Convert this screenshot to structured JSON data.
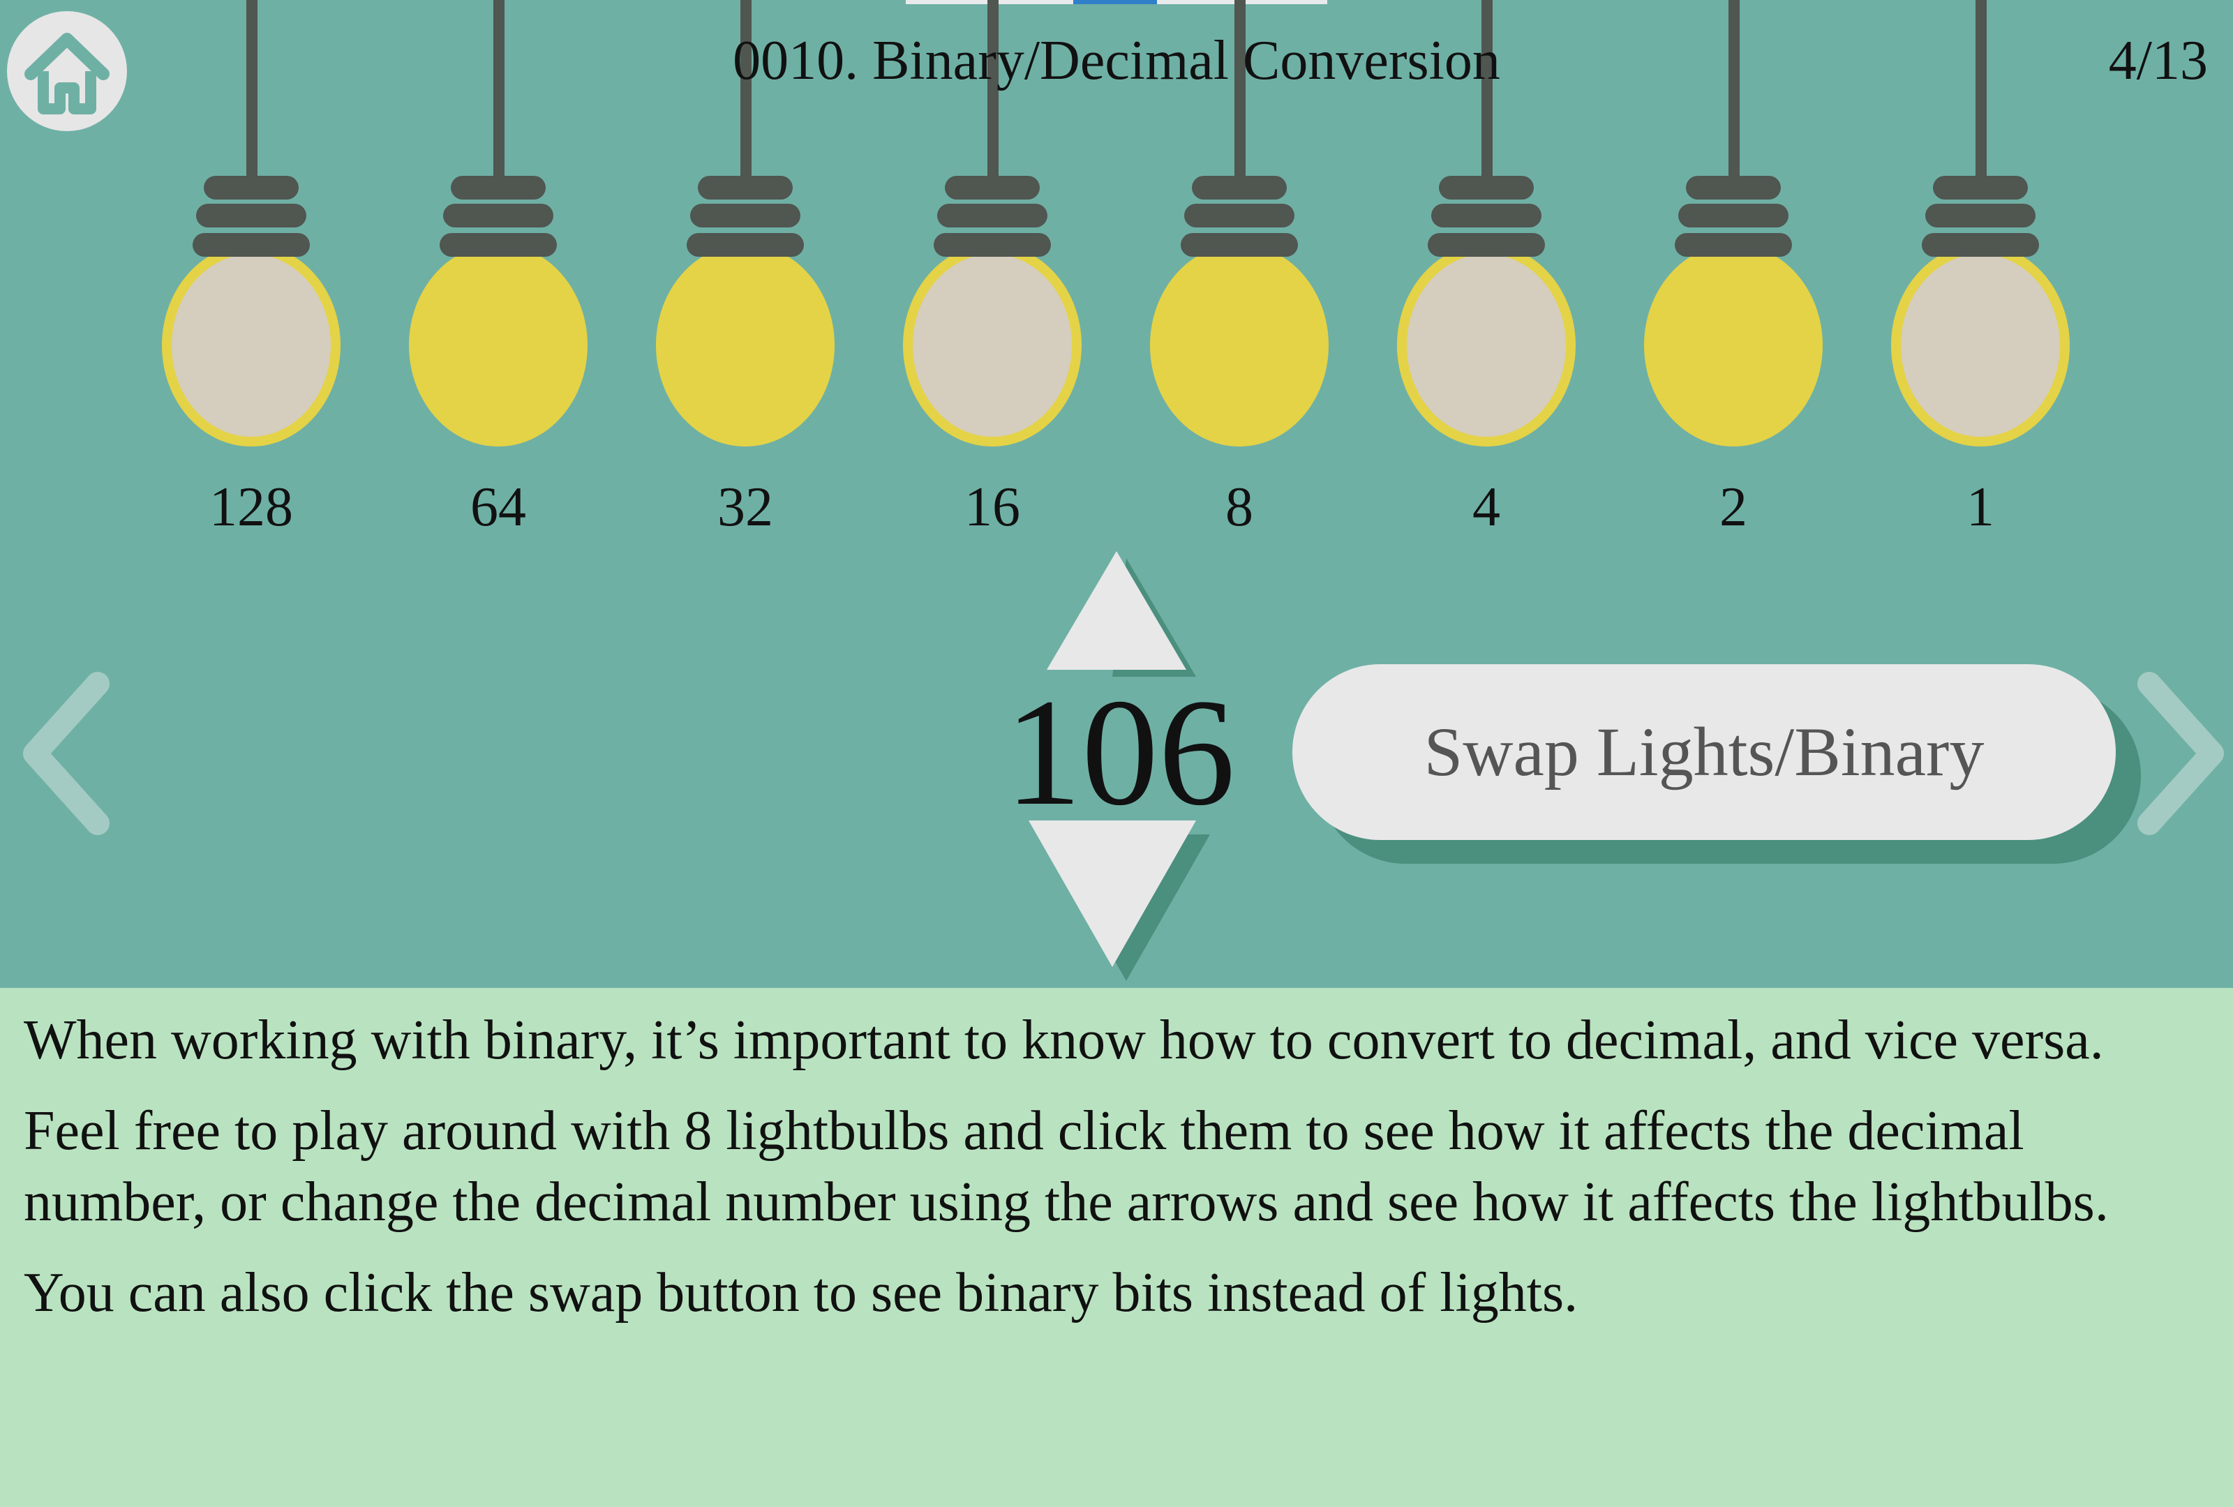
{
  "header": {
    "title": "0010. Binary/Decimal Conversion",
    "page_indicator": "4/13",
    "home_icon": "home-icon"
  },
  "bulbs": [
    {
      "value": "128",
      "lit": false
    },
    {
      "value": "64",
      "lit": true
    },
    {
      "value": "32",
      "lit": true
    },
    {
      "value": "16",
      "lit": false
    },
    {
      "value": "8",
      "lit": true
    },
    {
      "value": "4",
      "lit": false
    },
    {
      "value": "2",
      "lit": true
    },
    {
      "value": "1",
      "lit": false
    }
  ],
  "controls": {
    "decimal_value": "106",
    "swap_label": "Swap Lights/Binary",
    "up_icon": "triangle-up-icon",
    "down_icon": "triangle-down-icon"
  },
  "navigation": {
    "prev_icon": "chevron-left-icon",
    "next_icon": "chevron-right-icon"
  },
  "description": {
    "p1": "When working with binary, it’s important to know how to convert to decimal, and vice versa.",
    "p2": "Feel free to play around with 8 lightbulbs and click them to see how it affects the decimal number, or change the decimal number using the arrows and see how it affects the lightbulbs.",
    "p3": "You can also click the swap button to see binary bits instead of lights."
  },
  "colors": {
    "stage_bg": "#6fb0a5",
    "panel_bg": "#b9e3c0",
    "bulb_lit": "#e4d346",
    "bulb_off": "#d5cdbd",
    "fixture": "#505650",
    "button_bg": "#e8e8e8"
  }
}
